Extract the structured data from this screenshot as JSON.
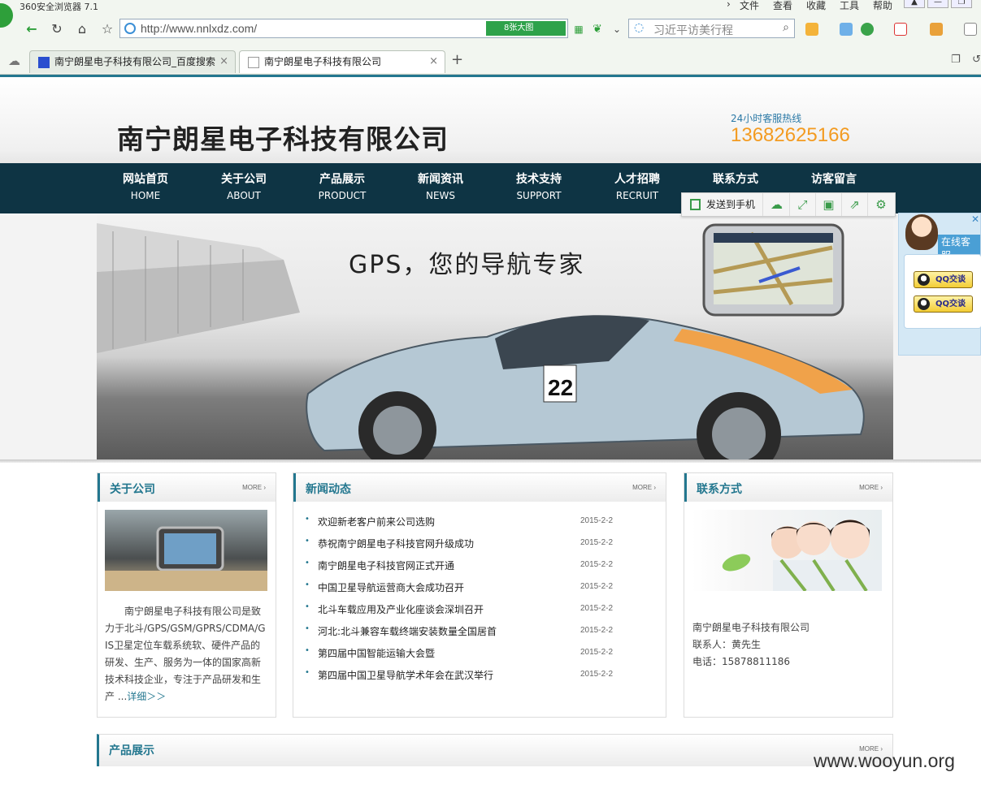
{
  "browser": {
    "name": "360安全浏览器 7.1",
    "menus": [
      "文件",
      "查看",
      "收藏",
      "工具",
      "帮助"
    ],
    "url": "http://www.nnlxdz.com/",
    "addr_badge": "8张大图",
    "search_placeholder": "习近平访美行程",
    "tabs": [
      {
        "label": "南宁朗星电子科技有限公司_百度搜索"
      },
      {
        "label": "南宁朗星电子科技有限公司"
      }
    ]
  },
  "header": {
    "company": "南宁朗星电子科技有限公司",
    "hotline_label": "24小时客服热线",
    "hotline_number": "13682625166"
  },
  "nav": [
    {
      "cn": "网站首页",
      "en": "HOME"
    },
    {
      "cn": "关于公司",
      "en": "ABOUT"
    },
    {
      "cn": "产品展示",
      "en": "PRODUCT"
    },
    {
      "cn": "新闻资讯",
      "en": "NEWS"
    },
    {
      "cn": "技术支持",
      "en": "SUPPORT"
    },
    {
      "cn": "人才招聘",
      "en": "RECRUIT"
    },
    {
      "cn": "联系方式",
      "en": ""
    },
    {
      "cn": "访客留言",
      "en": ""
    }
  ],
  "send_toolbar": {
    "send_label": "发送到手机"
  },
  "banner": {
    "headline": "GPS，您的导航专家"
  },
  "about": {
    "title": "关于公司",
    "more": "MORE",
    "text": "南宁朗星电子科技有限公司是致力于北斗/GPS/GSM/GPRS/CDMA/GIS卫星定位车载系统软、硬件产品的研发、生产、服务为一体的国家高新技术科技企业，专注于产品研发和生产",
    "ellipsis": "...",
    "more_link": "详细＞＞"
  },
  "news": {
    "title": "新闻动态",
    "more": "MORE",
    "items": [
      {
        "title": "欢迎新老客户前来公司选购",
        "date": "2015-2-2"
      },
      {
        "title": "恭祝南宁朗星电子科技官网升级成功",
        "date": "2015-2-2"
      },
      {
        "title": "南宁朗星电子科技官网正式开通",
        "date": "2015-2-2"
      },
      {
        "title": "中国卫星导航运营商大会成功召开",
        "date": "2015-2-2"
      },
      {
        "title": "北斗车载应用及产业化座谈会深圳召开",
        "date": "2015-2-2"
      },
      {
        "title": "河北:北斗兼容车载终端安装数量全国居首",
        "date": "2015-2-2"
      },
      {
        "title": "第四届中国智能运输大会暨",
        "date": "2015-2-2"
      },
      {
        "title": "第四届中国卫星导航学术年会在武汉举行",
        "date": "2015-2-2"
      }
    ]
  },
  "contact": {
    "title": "联系方式",
    "more": "MORE",
    "company": "南宁朗星电子科技有限公司",
    "person": "联系人：黄先生",
    "phone": "电话：15878811186"
  },
  "products": {
    "title": "产品展示",
    "more": "MORE"
  },
  "service": {
    "title": "在线客服",
    "qq1": "QQ交谈",
    "qq2": "QQ交谈"
  },
  "watermark": "www.wooyun.org"
}
